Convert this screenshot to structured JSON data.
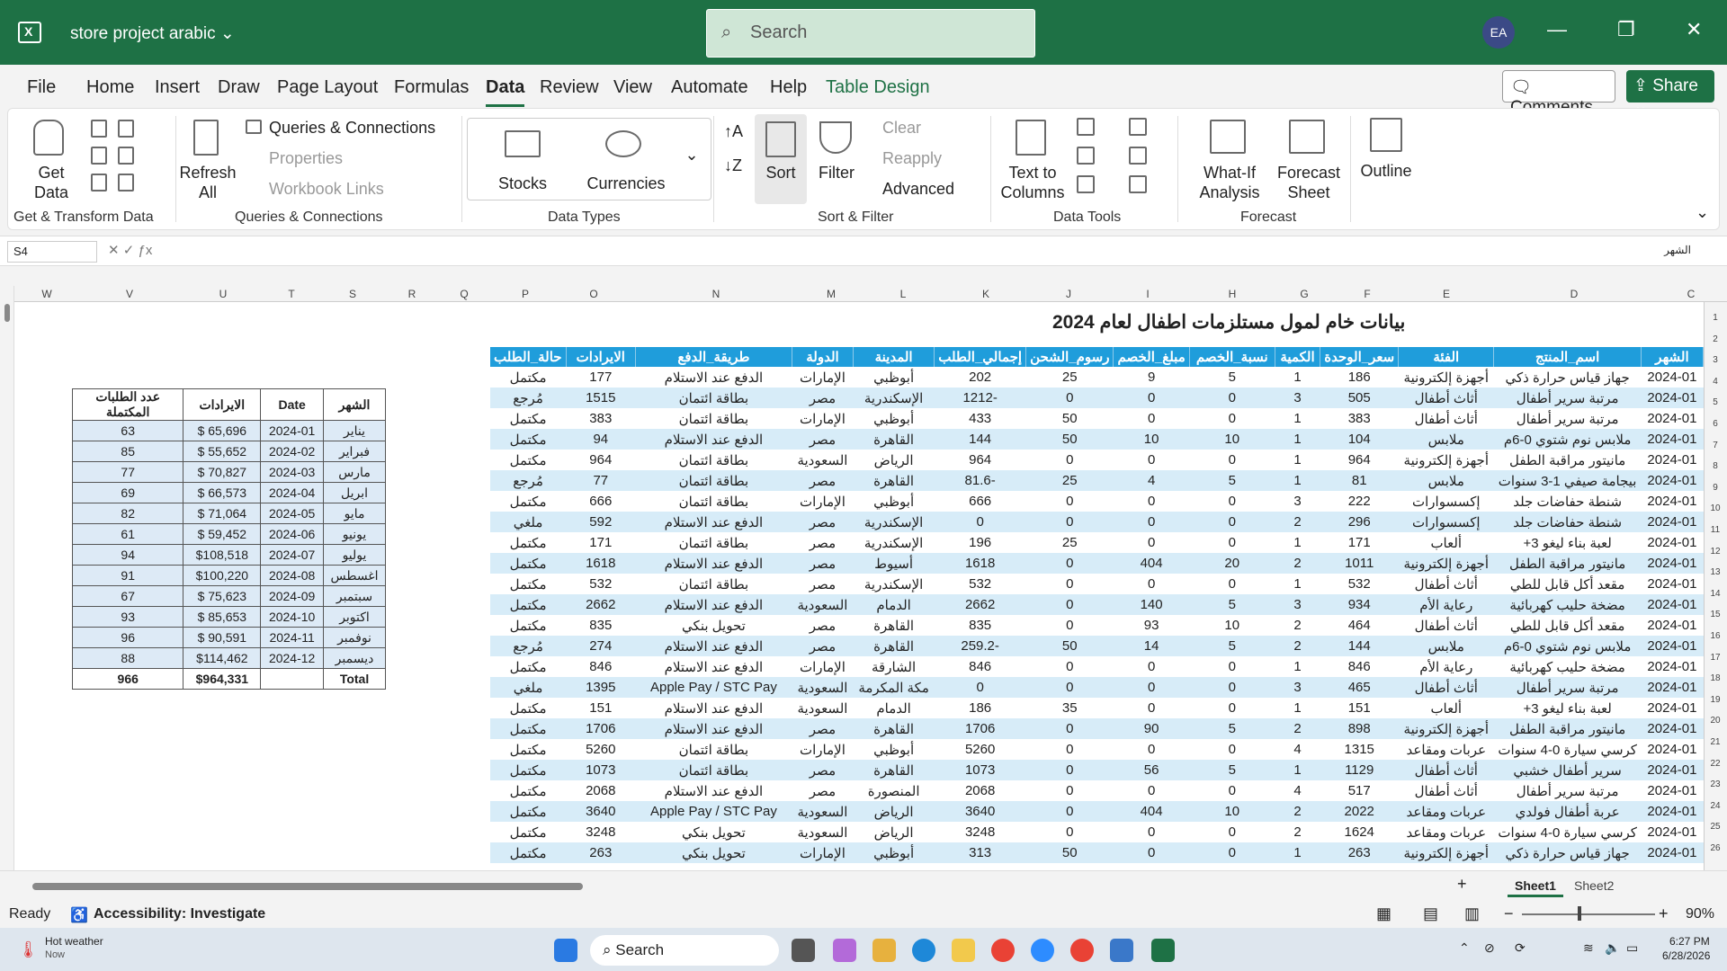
{
  "titlebar": {
    "doc_title": "store project arabic",
    "search_placeholder": "Search",
    "avatar_initials": "EA"
  },
  "menu": {
    "tabs": [
      "File",
      "Home",
      "Insert",
      "Draw",
      "Page Layout",
      "Formulas",
      "Data",
      "Review",
      "View",
      "Automate",
      "Help",
      "Table Design"
    ],
    "active": "Data",
    "comments": "Comments",
    "share": "Share"
  },
  "ribbon": {
    "get_data": "Get Data",
    "queries_connections": "Queries & Connections",
    "properties": "Properties",
    "workbook_links": "Workbook Links",
    "refresh_all": "Refresh All",
    "stocks": "Stocks",
    "currencies": "Currencies",
    "sort": "Sort",
    "filter": "Filter",
    "clear": "Clear",
    "reapply": "Reapply",
    "advanced": "Advanced",
    "text_to_columns": "Text to Columns",
    "what_if": "What-If Analysis",
    "forecast_sheet": "Forecast Sheet",
    "outline": "Outline",
    "groups": [
      "Get & Transform Data",
      "Queries & Connections",
      "Data Types",
      "Sort & Filter",
      "Data Tools",
      "Forecast"
    ]
  },
  "formula_bar": {
    "name_box": "S4",
    "content": "الشهر"
  },
  "columns": [
    "W",
    "V",
    "U",
    "T",
    "S",
    "R",
    "Q",
    "P",
    "O",
    "N",
    "M",
    "L",
    "K",
    "J",
    "I",
    "H",
    "G",
    "F",
    "E",
    "D",
    "C"
  ],
  "rows": [
    "1",
    "2",
    "3",
    "4",
    "5",
    "6",
    "7",
    "8",
    "9",
    "10",
    "11",
    "12",
    "13",
    "14",
    "15",
    "16",
    "17",
    "18",
    "19",
    "20",
    "21",
    "22",
    "23",
    "24",
    "25",
    "26"
  ],
  "sheet_title": "بيانات خام لمول مستلزمات اطفال لعام 2024",
  "main_table": {
    "headers": [
      "الشهر",
      "اسم_المنتج",
      "الفئة",
      "سعر_الوحدة",
      "الكمية",
      "نسبة_الخصم",
      "مبلغ_الخصم",
      "رسوم_الشحن",
      "إجمالي_الطلب",
      "المدينة",
      "الدولة",
      "طريقة_الدفع",
      "الايرادات",
      "حالة_الطلب"
    ],
    "rows": [
      [
        "2024-01",
        "جهاز قياس حرارة ذكي",
        "أجهزة إلكترونية",
        "186",
        "1",
        "5",
        "9",
        "25",
        "202",
        "أبوظبي",
        "الإمارات",
        "الدفع عند الاستلام",
        "177",
        "مكتمل"
      ],
      [
        "2024-01",
        "مرتبة سرير أطفال",
        "أثاث أطفال",
        "505",
        "3",
        "0",
        "0",
        "0",
        "-1212",
        "الإسكندرية",
        "مصر",
        "بطاقة ائتمان",
        "1515",
        "مُرجع"
      ],
      [
        "2024-01",
        "مرتبة سرير أطفال",
        "أثاث أطفال",
        "383",
        "1",
        "0",
        "0",
        "50",
        "433",
        "أبوظبي",
        "الإمارات",
        "بطاقة ائتمان",
        "383",
        "مكتمل"
      ],
      [
        "2024-01",
        "ملابس نوم شتوي 0-6م",
        "ملابس",
        "104",
        "1",
        "10",
        "10",
        "50",
        "144",
        "القاهرة",
        "مصر",
        "الدفع عند الاستلام",
        "94",
        "مكتمل"
      ],
      [
        "2024-01",
        "مانيتور مراقبة الطفل",
        "أجهزة إلكترونية",
        "964",
        "1",
        "0",
        "0",
        "0",
        "964",
        "الرياض",
        "السعودية",
        "بطاقة ائتمان",
        "964",
        "مكتمل"
      ],
      [
        "2024-01",
        "بيجامة صيفي 1-3 سنوات",
        "ملابس",
        "81",
        "1",
        "5",
        "4",
        "25",
        "-81.6",
        "القاهرة",
        "مصر",
        "بطاقة ائتمان",
        "77",
        "مُرجع"
      ],
      [
        "2024-01",
        "شنطة حفاضات جلد",
        "إكسسوارات",
        "222",
        "3",
        "0",
        "0",
        "0",
        "666",
        "أبوظبي",
        "الإمارات",
        "بطاقة ائتمان",
        "666",
        "مكتمل"
      ],
      [
        "2024-01",
        "شنطة حفاضات جلد",
        "إكسسوارات",
        "296",
        "2",
        "0",
        "0",
        "0",
        "0",
        "الإسكندرية",
        "مصر",
        "الدفع عند الاستلام",
        "592",
        "ملغي"
      ],
      [
        "2024-01",
        "لعبة بناء ليغو 3+",
        "ألعاب",
        "171",
        "1",
        "0",
        "0",
        "25",
        "196",
        "الإسكندرية",
        "مصر",
        "بطاقة ائتمان",
        "171",
        "مكتمل"
      ],
      [
        "2024-01",
        "مانيتور مراقبة الطفل",
        "أجهزة إلكترونية",
        "1011",
        "2",
        "20",
        "404",
        "0",
        "1618",
        "أسيوط",
        "مصر",
        "الدفع عند الاستلام",
        "1618",
        "مكتمل"
      ],
      [
        "2024-01",
        "مقعد أكل قابل للطي",
        "أثاث أطفال",
        "532",
        "1",
        "0",
        "0",
        "0",
        "532",
        "الإسكندرية",
        "مصر",
        "بطاقة ائتمان",
        "532",
        "مكتمل"
      ],
      [
        "2024-01",
        "مضخة حليب كهربائية",
        "رعاية الأم",
        "934",
        "3",
        "5",
        "140",
        "0",
        "2662",
        "الدمام",
        "السعودية",
        "الدفع عند الاستلام",
        "2662",
        "مكتمل"
      ],
      [
        "2024-01",
        "مقعد أكل قابل للطي",
        "أثاث أطفال",
        "464",
        "2",
        "10",
        "93",
        "0",
        "835",
        "القاهرة",
        "مصر",
        "تحويل بنكي",
        "835",
        "مكتمل"
      ],
      [
        "2024-01",
        "ملابس نوم شتوي 0-6م",
        "ملابس",
        "144",
        "2",
        "5",
        "14",
        "50",
        "-259.2",
        "القاهرة",
        "مصر",
        "الدفع عند الاستلام",
        "274",
        "مُرجع"
      ],
      [
        "2024-01",
        "مضخة حليب كهربائية",
        "رعاية الأم",
        "846",
        "1",
        "0",
        "0",
        "0",
        "846",
        "الشارقة",
        "الإمارات",
        "الدفع عند الاستلام",
        "846",
        "مكتمل"
      ],
      [
        "2024-01",
        "مرتبة سرير أطفال",
        "أثاث أطفال",
        "465",
        "3",
        "0",
        "0",
        "0",
        "0",
        "مكة المكرمة",
        "السعودية",
        "Apple Pay / STC Pay",
        "1395",
        "ملغي"
      ],
      [
        "2024-01",
        "لعبة بناء ليغو 3+",
        "ألعاب",
        "151",
        "1",
        "0",
        "0",
        "35",
        "186",
        "الدمام",
        "السعودية",
        "الدفع عند الاستلام",
        "151",
        "مكتمل"
      ],
      [
        "2024-01",
        "مانيتور مراقبة الطفل",
        "أجهزة إلكترونية",
        "898",
        "2",
        "5",
        "90",
        "0",
        "1706",
        "القاهرة",
        "مصر",
        "الدفع عند الاستلام",
        "1706",
        "مكتمل"
      ],
      [
        "2024-01",
        "كرسي سيارة 0-4 سنوات",
        "عربات ومقاعد",
        "1315",
        "4",
        "0",
        "0",
        "0",
        "5260",
        "أبوظبي",
        "الإمارات",
        "بطاقة ائتمان",
        "5260",
        "مكتمل"
      ],
      [
        "2024-01",
        "سرير أطفال خشبي",
        "أثاث أطفال",
        "1129",
        "1",
        "5",
        "56",
        "0",
        "1073",
        "القاهرة",
        "مصر",
        "بطاقة ائتمان",
        "1073",
        "مكتمل"
      ],
      [
        "2024-01",
        "مرتبة سرير أطفال",
        "أثاث أطفال",
        "517",
        "4",
        "0",
        "0",
        "0",
        "2068",
        "المنصورة",
        "مصر",
        "الدفع عند الاستلام",
        "2068",
        "مكتمل"
      ],
      [
        "2024-01",
        "عربة أطفال فولدي",
        "عربات ومقاعد",
        "2022",
        "2",
        "10",
        "404",
        "0",
        "3640",
        "الرياض",
        "السعودية",
        "Apple Pay / STC Pay",
        "3640",
        "مكتمل"
      ],
      [
        "2024-01",
        "كرسي سيارة 0-4 سنوات",
        "عربات ومقاعد",
        "1624",
        "2",
        "0",
        "0",
        "0",
        "3248",
        "الرياض",
        "السعودية",
        "تحويل بنكي",
        "3248",
        "مكتمل"
      ],
      [
        "2024-01",
        "جهاز قياس حرارة ذكي",
        "أجهزة إلكترونية",
        "263",
        "1",
        "0",
        "0",
        "50",
        "313",
        "أبوظبي",
        "الإمارات",
        "تحويل بنكي",
        "263",
        "مكتمل"
      ]
    ]
  },
  "summary_table": {
    "headers": [
      "الشهر",
      "Date",
      "الايرادات",
      "عدد الطلبات المكتملة"
    ],
    "rows": [
      [
        "يناير",
        "2024-01",
        "$ 65,696",
        "63"
      ],
      [
        "فبراير",
        "2024-02",
        "$ 55,652",
        "85"
      ],
      [
        "مارس",
        "2024-03",
        "$ 70,827",
        "77"
      ],
      [
        "ابريل",
        "2024-04",
        "$ 66,573",
        "69"
      ],
      [
        "مايو",
        "2024-05",
        "$ 71,064",
        "82"
      ],
      [
        "يونيو",
        "2024-06",
        "$ 59,452",
        "61"
      ],
      [
        "يوليو",
        "2024-07",
        "$108,518",
        "94"
      ],
      [
        "اغسطس",
        "2024-08",
        "$100,220",
        "91"
      ],
      [
        "سبتمبر",
        "2024-09",
        "$ 75,623",
        "67"
      ],
      [
        "اكتوبر",
        "2024-10",
        "$ 85,653",
        "93"
      ],
      [
        "نوفمبر",
        "2024-11",
        "$ 90,591",
        "96"
      ],
      [
        "ديسمبر",
        "2024-12",
        "$114,462",
        "88"
      ]
    ],
    "total": [
      "Total",
      "",
      "$964,331",
      "966"
    ]
  },
  "sheets": {
    "sheet1": "Sheet1",
    "sheet2": "Sheet2"
  },
  "status": {
    "ready": "Ready",
    "accessibility": "Accessibility: Investigate",
    "zoom": "90%"
  },
  "taskbar": {
    "weather_title": "Hot weather",
    "weather_sub": "Now",
    "search": "Search",
    "time": "6:27 PM",
    "date": "6/28/2026"
  }
}
